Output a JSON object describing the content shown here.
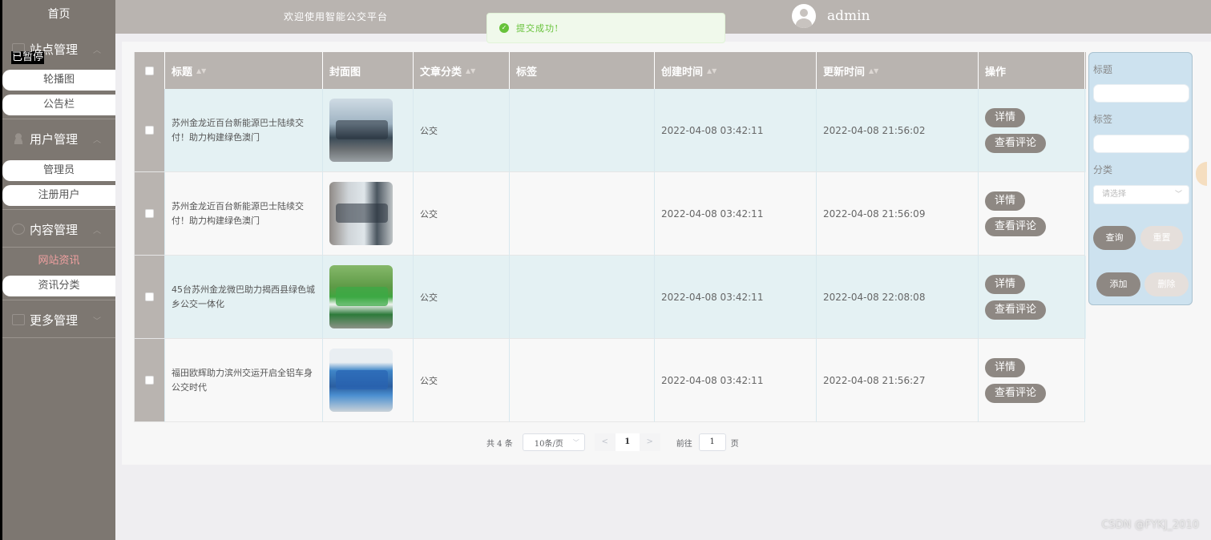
{
  "sidebar": {
    "home": "首页",
    "groups": [
      {
        "label": "站点管理",
        "items": [
          "轮播图",
          "公告栏"
        ]
      },
      {
        "label": "用户管理",
        "items": [
          "管理员",
          "注册用户"
        ]
      },
      {
        "label": "内容管理",
        "items": [
          "网站资讯",
          "资讯分类"
        ]
      },
      {
        "label": "更多管理",
        "items": []
      }
    ],
    "active_item": "网站资讯",
    "paused_overlay": "已暂停"
  },
  "header": {
    "welcome": "欢迎使用智能公交平台",
    "username": "admin"
  },
  "toast": {
    "message": "提交成功!",
    "color": "#67c23a"
  },
  "table": {
    "columns": [
      "标题",
      "封面图",
      "文章分类",
      "标签",
      "创建时间",
      "更新时间",
      "操作"
    ],
    "rows": [
      {
        "title": "苏州金龙近百台新能源巴士陆续交付！助力构建绿色澳门",
        "category": "公交",
        "tag": "",
        "created": "2022-04-08 03:42:11",
        "updated": "2022-04-08 21:56:02"
      },
      {
        "title": "苏州金龙近百台新能源巴士陆续交付！助力构建绿色澳门",
        "category": "公交",
        "tag": "",
        "created": "2022-04-08 03:42:11",
        "updated": "2022-04-08 21:56:09"
      },
      {
        "title": "45台苏州金龙微巴助力揭西县绿色城乡公交一体化",
        "category": "公交",
        "tag": "",
        "created": "2022-04-08 03:42:11",
        "updated": "2022-04-08 22:08:08"
      },
      {
        "title": "福田欧辉助力滨州交运开启全铝车身公交时代",
        "category": "公交",
        "tag": "",
        "created": "2022-04-08 03:42:11",
        "updated": "2022-04-08 21:56:27"
      }
    ],
    "detail_label": "详情",
    "comments_label": "查看评论"
  },
  "pagination": {
    "total": "共 4 条",
    "page_size": "10条/页",
    "prev": "<",
    "current_page": "1",
    "next": ">",
    "goto_label": "前往",
    "goto_value": "1",
    "page_suffix": "页"
  },
  "search_panel": {
    "title_label": "标题",
    "tag_label": "标签",
    "category_label": "分类",
    "category_placeholder": "请选择",
    "query_button": "查询",
    "reset_button": "重置",
    "add_button": "添加",
    "delete_button": "删除"
  },
  "watermark": "CSDN @FYKJ_2010",
  "colors": {
    "sidebar_bg": "#7d7771",
    "header_bg": "#b9b4b0",
    "button_dark": "#8e8883",
    "row_highlight": "#e4f1f3",
    "search_panel_bg": "#cde2ef"
  }
}
